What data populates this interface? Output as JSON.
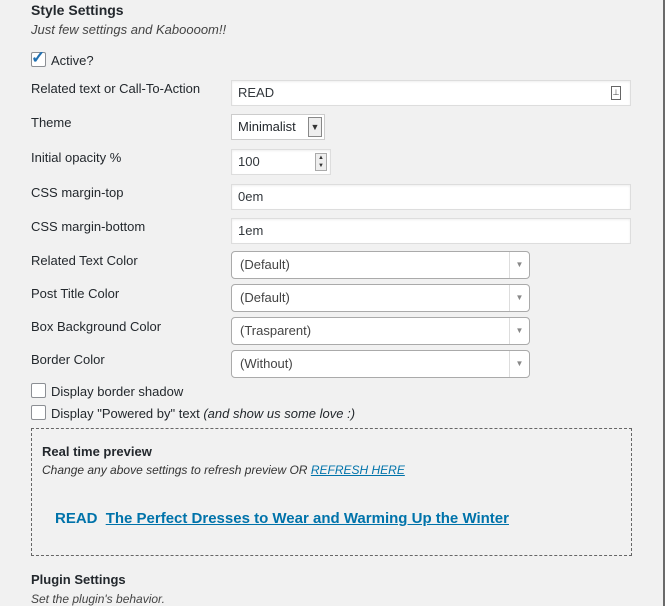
{
  "style_settings": {
    "title": "Style Settings",
    "description": "Just few settings and Kaboooom!!"
  },
  "active": {
    "label": "Active?",
    "checked": true
  },
  "fields": {
    "related_text": {
      "label": "Related text or Call-To-Action",
      "value": "READ"
    },
    "theme": {
      "label": "Theme",
      "value": "Minimalist"
    },
    "opacity": {
      "label": "Initial opacity %",
      "value": "100"
    },
    "margin_top": {
      "label": "CSS margin-top",
      "value": "0em"
    },
    "margin_bottom": {
      "label": "CSS margin-bottom",
      "value": "1em"
    },
    "related_text_color": {
      "label": "Related Text Color",
      "value": "(Default)"
    },
    "post_title_color": {
      "label": "Post Title Color",
      "value": "(Default)"
    },
    "box_bg_color": {
      "label": "Box Background Color",
      "value": "(Trasparent)"
    },
    "border_color": {
      "label": "Border Color",
      "value": "(Without)"
    }
  },
  "display_border_shadow": {
    "label": "Display border shadow",
    "checked": false
  },
  "display_powered_by": {
    "label": "Display \"Powered by\" text",
    "note": "(and show us some love :)",
    "checked": false
  },
  "preview": {
    "title": "Real time preview",
    "description": "Change any above settings to refresh preview OR",
    "refresh_link": "REFRESH HERE",
    "related_text": "READ",
    "post_title": "The Perfect Dresses to Wear and Warming Up the Winter"
  },
  "plugin_settings": {
    "title": "Plugin Settings",
    "description": "Set the plugin's behavior."
  },
  "colors": {
    "link": "#0073aa",
    "checkbox_tick": "#2271b1"
  }
}
